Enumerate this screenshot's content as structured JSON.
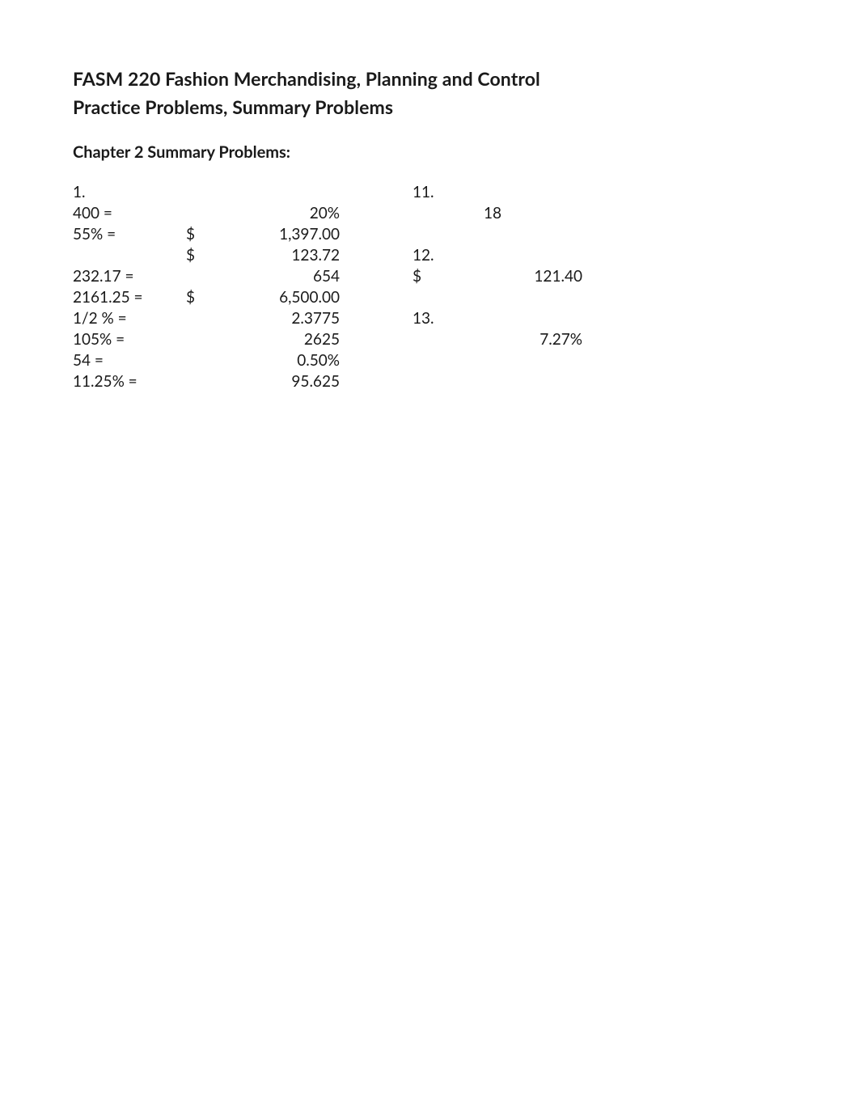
{
  "header": {
    "title": "FASM 220 Fashion Merchandising, Planning and Control",
    "subtitle": "Practice Problems, Summary Problems"
  },
  "section": {
    "heading": "Chapter 2 Summary Problems:"
  },
  "rows": [
    {
      "a": "1.",
      "b": "",
      "c": "",
      "d": "11.",
      "e": "",
      "f": ""
    },
    {
      "a": "400 =",
      "b": "",
      "c": "20%",
      "d": "",
      "e": "18",
      "f": ""
    },
    {
      "a": "55% =",
      "b": "$",
      "c": "1,397.00",
      "d": "",
      "e": "",
      "f": ""
    },
    {
      "a": "",
      "b": "$",
      "c": "123.72",
      "d": "12.",
      "e": "",
      "f": ""
    },
    {
      "a": "232.17 =",
      "b": "",
      "c": "654",
      "d": "$",
      "e": "",
      "f": "121.40"
    },
    {
      "a": "2161.25 =",
      "b": "$",
      "c": "6,500.00",
      "d": "",
      "e": "",
      "f": ""
    },
    {
      "a": "1/2 % =",
      "b": "",
      "c": "2.3775",
      "d": "13.",
      "e": "",
      "f": ""
    },
    {
      "a": "105% =",
      "b": "",
      "c": "2625",
      "d": "",
      "e": "",
      "f": "7.27%"
    },
    {
      "a": "54 =",
      "b": "",
      "c": "0.50%",
      "d": "",
      "e": "",
      "f": ""
    },
    {
      "a": "11.25% =",
      "b": "",
      "c": "95.625",
      "d": "",
      "e": "",
      "f": ""
    }
  ]
}
